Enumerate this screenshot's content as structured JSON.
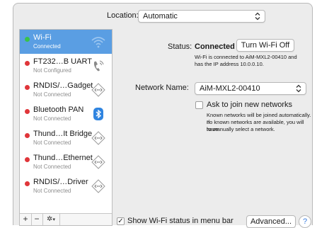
{
  "location": {
    "label": "Location:",
    "value": "Automatic"
  },
  "services": [
    {
      "name": "Wi-Fi",
      "status": "Connected",
      "dot": "#39c24a",
      "icon": "wifi-icon",
      "selected": true
    },
    {
      "name": "FT232…B UART",
      "status": "Not Configured",
      "dot": "#e0363a",
      "icon": "phone-icon"
    },
    {
      "name": "RNDIS/…Gadget",
      "status": "Not Connected",
      "dot": "#e0363a",
      "icon": "ethernet-icon"
    },
    {
      "name": "Bluetooth PAN",
      "status": "Not Connected",
      "dot": "#e0363a",
      "icon": "bluetooth-icon"
    },
    {
      "name": "Thund…It Bridge",
      "status": "Not Connected",
      "dot": "#e0363a",
      "icon": "ethernet-icon"
    },
    {
      "name": "Thund…Ethernet",
      "status": "Not Connected",
      "dot": "#e0363a",
      "icon": "ethernet-icon"
    },
    {
      "name": "RNDIS/…Driver",
      "status": "Not Connected",
      "dot": "#e0363a",
      "icon": "ethernet-icon"
    }
  ],
  "sidebar_tools": {
    "add": "+",
    "remove": "−",
    "gear": "✲"
  },
  "main": {
    "status_label": "Status:",
    "status_value": "Connected",
    "turn_off_button": "Turn Wi-Fi Off",
    "status_detail_1": "Wi-Fi is connected to AiM-MXL2-00410 and",
    "status_detail_2": "has the IP address 10.0.0.10.",
    "network_label": "Network Name:",
    "network_value": "AiM-MXL2-00410",
    "ask_join_label": "Ask to join new networks",
    "ask_join_checked": false,
    "ask_join_detail_1": "Known networks will be joined automatically. If",
    "ask_join_detail_2": "no known networks are available, you will have",
    "ask_join_detail_3": "to manually select a network.",
    "show_status_label": "Show Wi-Fi status in menu bar",
    "show_status_checked": true,
    "advanced_button": "Advanced...",
    "help_button": "?"
  },
  "colors": {
    "selection": "#5a9ee3",
    "green": "#39c24a",
    "red": "#e0363a"
  }
}
